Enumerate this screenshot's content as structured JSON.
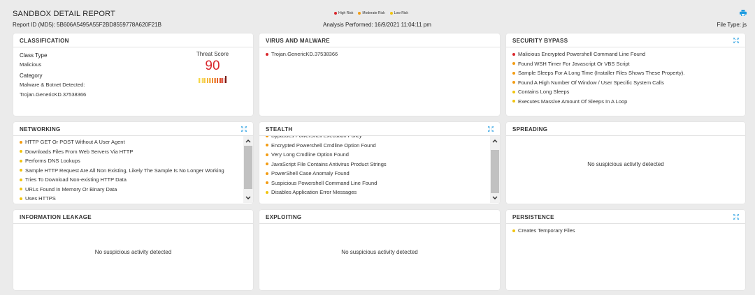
{
  "header": {
    "title": "SANDBOX DETAIL REPORT",
    "report_id": "Report ID (MD5): 5B606A5495A55F2BD8559778A620F21B",
    "analysis": "Analysis Performed: 16/9/2021 11:04:11 pm",
    "file_type": "File Type: js",
    "legend": [
      {
        "label": "High Risk",
        "color": "#d9262c"
      },
      {
        "label": "Moderate Risk",
        "color": "#f39c12"
      },
      {
        "label": "Low Risk",
        "color": "#f1c40f"
      }
    ]
  },
  "colors": {
    "high": "#d9262c",
    "moderate": "#f39c12",
    "low": "#f1c40f",
    "accent": "#1e9be0"
  },
  "classification": {
    "title": "CLASSIFICATION",
    "class_type_label": "Class Type",
    "class_type_value": "Malicious",
    "category_label": "Category",
    "category_value_1": "Malware & Botnet Detected:",
    "category_value_2": "Trojan.GenericKD.37538366",
    "threat_label": "Threat Score",
    "threat_score": "90"
  },
  "virus": {
    "title": "VIRUS AND MALWARE",
    "items": [
      {
        "text": "Trojan.GenericKD.37538366",
        "risk": "high"
      }
    ]
  },
  "security_bypass": {
    "title": "SECURITY BYPASS",
    "items": [
      {
        "text": "Malicious Encrypted Powershell Command Line Found",
        "risk": "high"
      },
      {
        "text": "Found WSH Timer For Javascript Or VBS Script",
        "risk": "moderate"
      },
      {
        "text": "Sample Sleeps For A Long Time (Installer Files Shows These Property).",
        "risk": "moderate"
      },
      {
        "text": "Found A High Number Of Window / User Specific System Calls",
        "risk": "moderate"
      },
      {
        "text": "Contains Long Sleeps",
        "risk": "low"
      },
      {
        "text": "Executes Massive Amount Of Sleeps In A Loop",
        "risk": "low"
      }
    ]
  },
  "networking": {
    "title": "NETWORKING",
    "items": [
      {
        "text": "HTTP GET Or POST Without A User Agent",
        "risk": "moderate"
      },
      {
        "text": "Downloads Files From Web Servers Via HTTP",
        "risk": "low"
      },
      {
        "text": "Performs DNS Lookups",
        "risk": "low"
      },
      {
        "text": "Sample HTTP Request Are All Non Existing, Likely The Sample Is No Longer Working",
        "risk": "low"
      },
      {
        "text": "Tries To Download Non-existing HTTP Data",
        "risk": "low"
      },
      {
        "text": "URLs Found In Memory Or Binary Data",
        "risk": "low"
      },
      {
        "text": "Uses HTTPS",
        "risk": "low"
      }
    ]
  },
  "stealth": {
    "title": "STEALTH",
    "items": [
      {
        "text": "Bypasses PowerShell Execution Policy",
        "risk": "moderate"
      },
      {
        "text": "Encrypted Powershell Cmdline Option Found",
        "risk": "moderate"
      },
      {
        "text": "Very Long Cmdline Option Found",
        "risk": "moderate"
      },
      {
        "text": "JavaScript File Contains Antivirus Product Strings",
        "risk": "moderate"
      },
      {
        "text": "PowerShell Case Anomaly Found",
        "risk": "moderate"
      },
      {
        "text": "Suspicious Powershell Command Line Found",
        "risk": "moderate"
      },
      {
        "text": "Disables Application Error Messages",
        "risk": "low"
      }
    ]
  },
  "spreading": {
    "title": "SPREADING",
    "empty": "No suspicious activity detected"
  },
  "info_leakage": {
    "title": "INFORMATION LEAKAGE",
    "empty": "No suspicious activity detected"
  },
  "exploiting": {
    "title": "EXPLOITING",
    "empty": "No suspicious activity detected"
  },
  "persistence": {
    "title": "PERSISTENCE",
    "items": [
      {
        "text": "Creates Temporary Files",
        "risk": "low"
      }
    ]
  }
}
